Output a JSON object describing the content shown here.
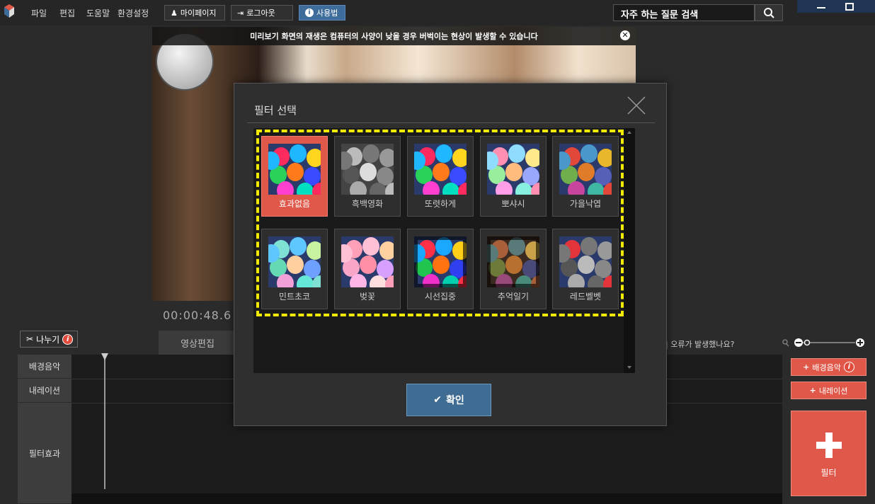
{
  "menu": [
    "파일",
    "편집",
    "도움말",
    "환경설정"
  ],
  "top_buttons": {
    "mypage": "마이페이지",
    "logout": "로그아웃",
    "help": "사용법"
  },
  "search": {
    "value": "자주 하는 질문 검색"
  },
  "preview": {
    "notice": "미리보기 화면의 재생은 컴퓨터의 사양이 낮을 경우 버벅이는 현상이 발생할 수 있습니다",
    "timecode": "00:00:48.6"
  },
  "toolbar": {
    "split_label": "나누기",
    "edit_tab": "영상편집",
    "error_link": "오류가 발생했나요?"
  },
  "tracks": [
    "배경음악",
    "내레이션",
    "필터효과"
  ],
  "side_buttons": {
    "bgm": "배경음악",
    "narration": "내레이션",
    "filter": "필터"
  },
  "modal": {
    "title": "필터 선택",
    "filters": [
      {
        "label": "효과없음",
        "selected": true
      },
      {
        "label": "흑백영화",
        "selected": false
      },
      {
        "label": "또렷하게",
        "selected": false
      },
      {
        "label": "뽀샤시",
        "selected": false
      },
      {
        "label": "가을낙엽",
        "selected": false
      },
      {
        "label": "민트초코",
        "selected": false
      },
      {
        "label": "벚꽃",
        "selected": false
      },
      {
        "label": "시선집중",
        "selected": false
      },
      {
        "label": "추억일기",
        "selected": false
      },
      {
        "label": "레드벨벳",
        "selected": false
      }
    ],
    "confirm": "확인"
  },
  "colors": {
    "accent": "#e0584a",
    "confirm": "#3f6c93",
    "highlight": "#f2ea00"
  }
}
